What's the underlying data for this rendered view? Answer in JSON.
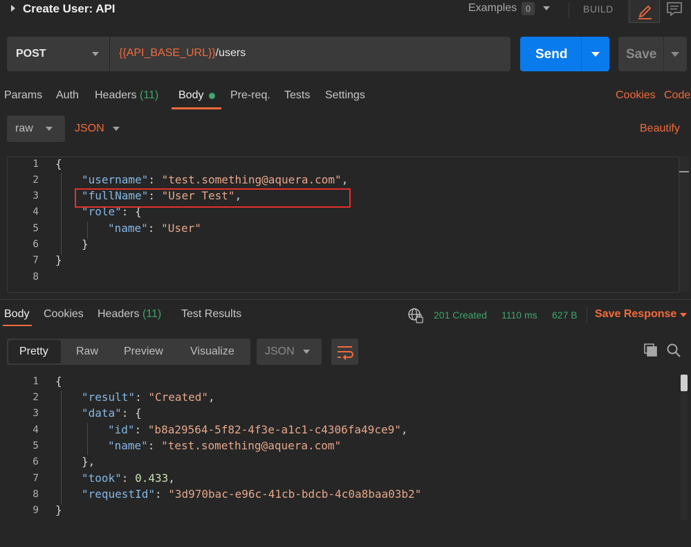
{
  "request": {
    "title": "Create User: API",
    "examples_label": "Examples",
    "examples_count": "0",
    "build_label": "BUILD",
    "method": "POST",
    "url_variable": "{{API_BASE_URL}}",
    "url_path": "/users",
    "send_label": "Send",
    "save_label": "Save"
  },
  "request_tabs": {
    "params": "Params",
    "auth": "Auth",
    "headers": "Headers",
    "headers_count": "(11)",
    "body": "Body",
    "prereq": "Pre-req.",
    "tests": "Tests",
    "settings": "Settings",
    "cookies": "Cookies",
    "code": "Code"
  },
  "body_format": {
    "mode": "raw",
    "language": "JSON",
    "beautify": "Beautify"
  },
  "request_body": {
    "line_numbers": [
      "1",
      "2",
      "3",
      "4",
      "5",
      "6",
      "7",
      "8"
    ],
    "open_brace": "{",
    "username_key": "\"username\"",
    "username_value": "\"test.something@aquera.com\"",
    "fullname_key": "\"fullName\"",
    "fullname_value": "\"User Test\"",
    "role_key": "\"role\"",
    "name_key": "\"name\"",
    "name_value": "\"User\"",
    "inner_close": "}",
    "close_brace": "}"
  },
  "response_tabs": {
    "body": "Body",
    "cookies": "Cookies",
    "headers": "Headers",
    "headers_count": "(11)",
    "test_results": "Test Results"
  },
  "response_status": {
    "status": "201 Created",
    "time": "1110 ms",
    "size": "627 B",
    "save_response": "Save Response"
  },
  "response_view": {
    "pretty": "Pretty",
    "raw": "Raw",
    "preview": "Preview",
    "visualize": "Visualize",
    "language": "JSON"
  },
  "response_body": {
    "line_numbers": [
      "1",
      "2",
      "3",
      "4",
      "5",
      "6",
      "7",
      "8",
      "9"
    ],
    "open_brace": "{",
    "result_key": "\"result\"",
    "result_value": "\"Created\"",
    "data_key": "\"data\"",
    "id_key": "\"id\"",
    "id_value": "\"b8a29564-5f82-4f3e-a1c1-c4306fa49ce9\"",
    "name_key": "\"name\"",
    "name_value": "\"test.something@aquera.com\"",
    "data_close": "},",
    "took_key": "\"took\"",
    "took_value": "0.433",
    "requestid_key": "\"requestId\"",
    "requestid_value": "\"3d970bac-e96c-41cb-bdcb-4c0a8baa03b2\"",
    "close_brace": "}"
  },
  "colors": {
    "accent_orange": "#f26b3a",
    "send_blue": "#097bed",
    "status_green": "#3fa66b",
    "highlight_red": "#e2332a"
  },
  "icons": [
    "edit-pencil-icon",
    "comment-icon",
    "globe-icon",
    "wrap-icon",
    "copy-icon",
    "search-icon"
  ]
}
